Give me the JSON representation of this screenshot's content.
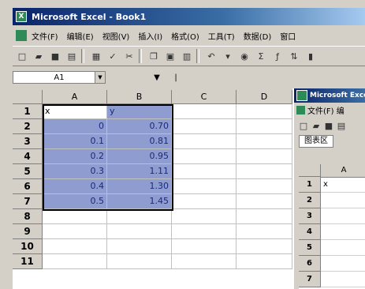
{
  "window": {
    "title": "Microsoft Excel - Book1",
    "icon": "excel-icon"
  },
  "menu": [
    "文件(F)",
    "编辑(E)",
    "视图(V)",
    "插入(I)",
    "格式(O)",
    "工具(T)",
    "数据(D)",
    "窗口"
  ],
  "toolbar_icons": [
    "new-icon",
    "open-icon",
    "save-icon",
    "print-icon",
    "preview-icon",
    "spelling-icon",
    "cut-icon",
    "copy-icon",
    "paste-icon",
    "undo-icon",
    "sort-icon",
    "font-icon",
    "bold-icon"
  ],
  "formula_bar": {
    "name_box": "A1",
    "value": ""
  },
  "columns": [
    "A",
    "B",
    "C",
    "D"
  ],
  "rows": [
    {
      "n": "1",
      "a": "x",
      "b": "y"
    },
    {
      "n": "2",
      "a": "0",
      "b": "0.70"
    },
    {
      "n": "3",
      "a": "0.1",
      "b": "0.81"
    },
    {
      "n": "4",
      "a": "0.2",
      "b": "0.95"
    },
    {
      "n": "5",
      "a": "0.3",
      "b": "1.11"
    },
    {
      "n": "6",
      "a": "0.4",
      "b": "1.30"
    },
    {
      "n": "7",
      "a": "0.5",
      "b": "1.45"
    },
    {
      "n": "8",
      "a": "",
      "b": ""
    },
    {
      "n": "9",
      "a": "",
      "b": ""
    },
    {
      "n": "10",
      "a": "",
      "b": ""
    },
    {
      "n": "11",
      "a": "",
      "b": ""
    }
  ],
  "second_window": {
    "title": "Microsoft Excel",
    "menu": "文件(F) 编",
    "name_box": "图表区",
    "column": "A",
    "rows": [
      {
        "n": "1",
        "v": "x"
      },
      {
        "n": "2",
        "v": ""
      },
      {
        "n": "3",
        "v": ""
      },
      {
        "n": "4",
        "v": ""
      },
      {
        "n": "5",
        "v": ""
      },
      {
        "n": "6",
        "v": ""
      },
      {
        "n": "7",
        "v": ""
      }
    ]
  }
}
